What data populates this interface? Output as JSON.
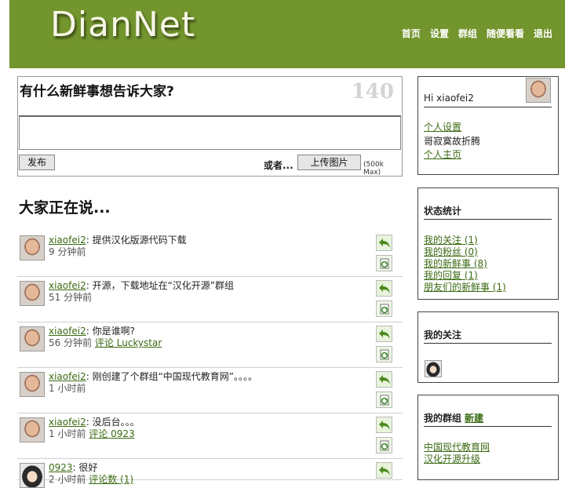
{
  "header": {
    "logo": "DianNet",
    "nav": [
      "首页",
      "设置",
      "群组",
      "随便看看",
      "退出"
    ]
  },
  "compose": {
    "title": "有什么新鲜事想告诉大家?",
    "counter": "140",
    "text": "",
    "publish_label": "发布",
    "or_label": "或者...",
    "upload_label": "上传图片",
    "size_limit": "(500k Max)"
  },
  "feed": {
    "title": "大家正在说...",
    "items": [
      {
        "user": "xiaofei2",
        "text": ": 提供汉化版源代码下载",
        "time": "9 分钟前",
        "link": "",
        "avatar": "face",
        "retweet": true
      },
      {
        "user": "xiaofei2",
        "text": ": 开源，下载地址在“汉化开源”群组",
        "time": "51 分钟前",
        "link": "",
        "avatar": "face",
        "retweet": true
      },
      {
        "user": "xiaofei2",
        "text": ": 你是谁啊?",
        "time": "56 分钟前",
        "link": "评论 Luckystar",
        "avatar": "face",
        "retweet": true
      },
      {
        "user": "xiaofei2",
        "text": ": 刚创建了个群组“中国现代教育网”。。。。",
        "time": "1 小时前",
        "link": "",
        "avatar": "face",
        "retweet": true
      },
      {
        "user": "xiaofei2",
        "text": ": 没后台。。。",
        "time": "1 小时前",
        "link": "评论 0923",
        "avatar": "face",
        "retweet": true
      },
      {
        "user": "0923",
        "text": ": 很好",
        "time": "2 小时前",
        "link": "评论数 (1)",
        "avatar": "girl",
        "retweet": false
      }
    ]
  },
  "sidebar": {
    "user": {
      "greeting": "Hi xiaofei2",
      "settings_link": "个人设置",
      "motto": "哥寂寞故折腾",
      "home_link": "个人主页"
    },
    "stats": {
      "title": "状态统计",
      "items": [
        "我的关注 (1)",
        "我的粉丝 (0)",
        "我的新鲜事 (8)",
        "我的回复 (1)",
        "朋友们的新鲜事 (1)"
      ]
    },
    "follow": {
      "title": "我的关注"
    },
    "groups": {
      "title": "我的群组",
      "new_link": "新建",
      "items": [
        "中国现代教育网",
        "汉化开源升级"
      ]
    }
  },
  "colors": {
    "header_bg": "#73952d",
    "link": "#3a6a12"
  }
}
